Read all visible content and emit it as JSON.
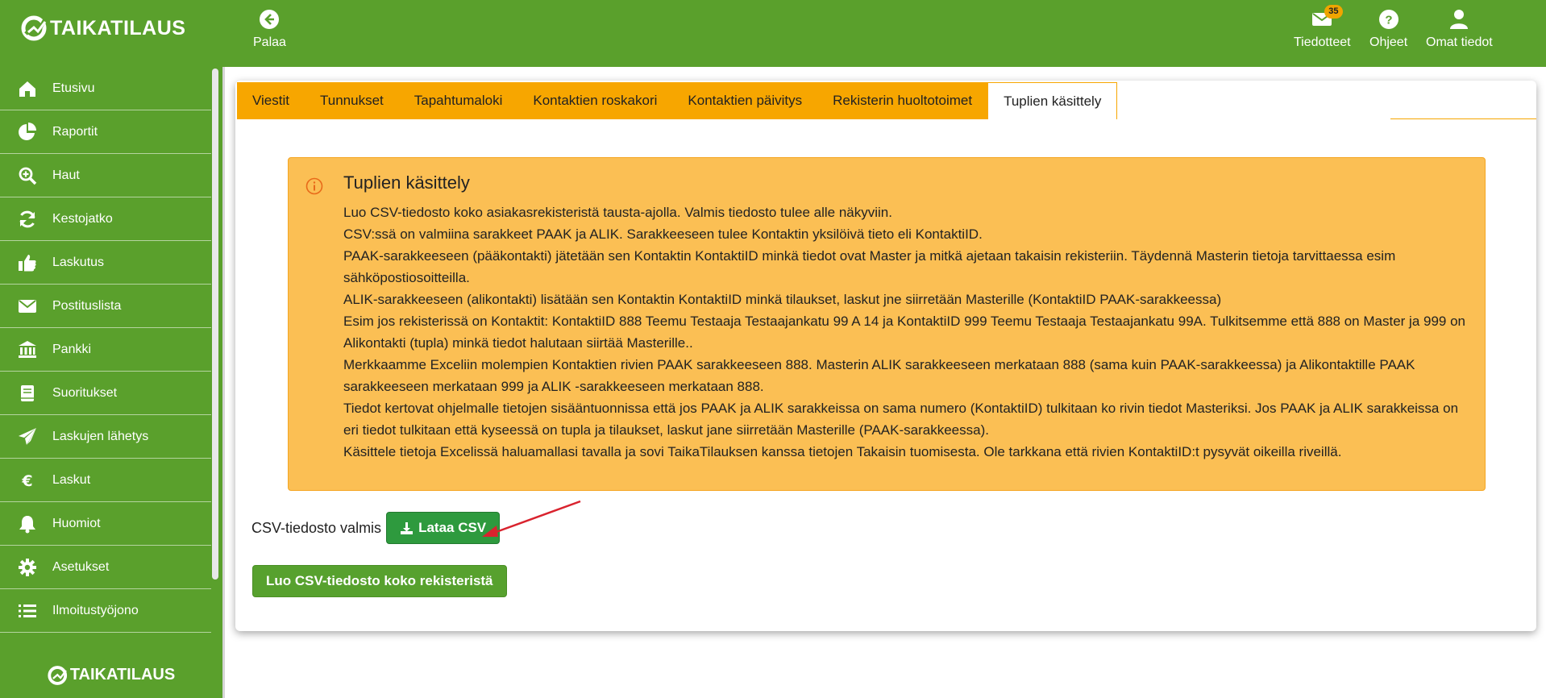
{
  "header": {
    "logo_text": "TAIKATILAUS",
    "back_label": "Palaa",
    "notices_label": "Tiedotteet",
    "notices_count": "35",
    "help_label": "Ohjeet",
    "profile_label": "Omat tiedot"
  },
  "sidebar": {
    "items": [
      {
        "label": "Etusivu",
        "icon": "home-icon"
      },
      {
        "label": "Raportit",
        "icon": "pie-chart-icon"
      },
      {
        "label": "Haut",
        "icon": "zoom-in-icon"
      },
      {
        "label": "Kestojatko",
        "icon": "refresh-icon"
      },
      {
        "label": "Laskutus",
        "icon": "thumbs-up-icon"
      },
      {
        "label": "Postituslista",
        "icon": "envelope-icon"
      },
      {
        "label": "Pankki",
        "icon": "bank-icon"
      },
      {
        "label": "Suoritukset",
        "icon": "book-icon"
      },
      {
        "label": "Laskujen lähetys",
        "icon": "paper-plane-icon"
      },
      {
        "label": "Laskut",
        "icon": "euro-icon"
      },
      {
        "label": "Huomiot",
        "icon": "bell-icon"
      },
      {
        "label": "Asetukset",
        "icon": "gear-icon"
      },
      {
        "label": "Ilmoitustyöjono",
        "icon": "list-icon"
      }
    ],
    "footer_logo": "TAIKATILAUS"
  },
  "tabs": [
    {
      "label": "Viestit",
      "active": false
    },
    {
      "label": "Tunnukset",
      "active": false
    },
    {
      "label": "Tapahtumaloki",
      "active": false
    },
    {
      "label": "Kontaktien roskakori",
      "active": false
    },
    {
      "label": "Kontaktien päivitys",
      "active": false
    },
    {
      "label": "Rekisterin huoltotoimet",
      "active": false
    },
    {
      "label": "Tuplien käsittely",
      "active": true
    }
  ],
  "info": {
    "title": "Tuplien käsittely",
    "lines": [
      "Luo CSV-tiedosto koko asiakasrekisteristä tausta-ajolla. Valmis tiedosto tulee alle näkyviin.",
      "CSV:ssä on valmiina sarakkeet PAAK ja ALIK. Sarakkeeseen tulee Kontaktin yksilöivä tieto eli KontaktiID.",
      "PAAK-sarakkeeseen (pääkontakti) jätetään sen Kontaktin KontaktiID minkä tiedot ovat Master ja mitkä ajetaan takaisin rekisteriin. Täydennä Masterin tietoja tarvittaessa esim sähköpostiosoitteilla.",
      "ALIK-sarakkeeseen (alikontakti) lisätään sen Kontaktin KontaktiID minkä tilaukset, laskut jne siirretään Masterille (KontaktiID PAAK-sarakkeessa)",
      "Esim jos rekisterissä on Kontaktit: KontaktiID 888 Teemu Testaaja Testaajankatu 99 A 14 ja KontaktiID 999 Teemu Testaaja Testaajankatu 99A. Tulkitsemme että 888 on Master ja 999 on Alikontakti (tupla) minkä tiedot halutaan siirtää Masterille..",
      "Merkkaamme Exceliin molempien Kontaktien rivien PAAK sarakkeeseen 888. Masterin ALIK sarakkeeseen merkataan 888 (sama kuin PAAK-sarakkeessa) ja Alikontaktille PAAK sarakkeeseen merkataan 999 ja ALIK -sarakkeeseen merkataan 888.",
      "Tiedot kertovat ohjelmalle tietojen sisääntuonnissa että jos PAAK ja ALIK sarakkeissa on sama numero (KontaktiID) tulkitaan ko rivin tiedot Masteriksi. Jos PAAK ja ALIK sarakkeissa on eri tiedot tulkitaan että kyseessä on tupla ja tilaukset, laskut jane siirretään Masterille (PAAK-sarakkeessa).",
      "Käsittele tietoja Excelissä haluamallasi tavalla ja sovi TaikaTilauksen kanssa tietojen Takaisin tuomisesta. Ole tarkkana että rivien KontaktiID:t pysyvät oikeilla riveillä."
    ]
  },
  "csv": {
    "ready_label": "CSV-tiedosto valmis",
    "download_label": "Lataa CSV",
    "create_label": "Luo CSV-tiedosto koko rekisteristä"
  },
  "colors": {
    "brand_green": "#5aa02c",
    "tab_orange": "#f7a600",
    "info_bg": "#fbbf54",
    "button_green": "#2e9a3e",
    "annotation_arrow": "#d9232e"
  }
}
